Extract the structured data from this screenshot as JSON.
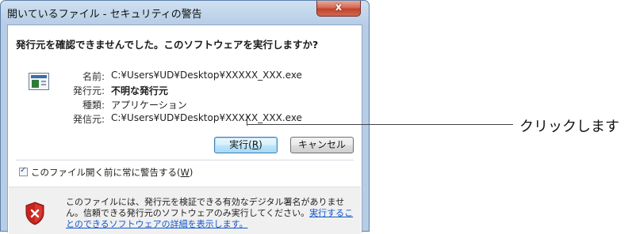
{
  "window": {
    "title": "開いているファイル - セキュリティの警告",
    "close_glyph": "x"
  },
  "question": "発行元を確認できませんでした。このソフトウェアを実行しますか?",
  "details": {
    "name_label": "名前:",
    "name_value": "C:¥Users¥UD¥Desktop¥XXXXX_XXX.exe",
    "publisher_label": "発行元:",
    "publisher_value": "不明な発行元",
    "type_label": "種類:",
    "type_value": "アプリケーション",
    "from_label": "発信元:",
    "from_value": "C:¥Users¥UD¥Desktop¥XXXXX_XXX.exe"
  },
  "buttons": {
    "run_prefix": "実行(",
    "run_accel": "R",
    "run_suffix": ")",
    "cancel": "キャンセル"
  },
  "checkbox": {
    "checked": true,
    "label_prefix": "このファイル開く前に常に警告する(",
    "label_accel": "W",
    "label_suffix": ")"
  },
  "warning": {
    "text": "このファイルには、発行元を検証できる有効なデジタル署名がありません。信頼できる発行元のソフトウェアのみ実行してください。",
    "link": "実行することのできるソフトウェアの詳細を表示します。"
  },
  "annotation": {
    "callout": "クリックします"
  },
  "icons": {
    "app": "application-file-icon",
    "shield": "security-shield-icon",
    "check": "checkmark-icon"
  },
  "colors": {
    "title_gradient_top": "#cfe0f1",
    "close_red": "#c2412a",
    "default_button_border": "#3c7fb1",
    "link": "#1155cc",
    "shield_red": "#c8241d"
  }
}
